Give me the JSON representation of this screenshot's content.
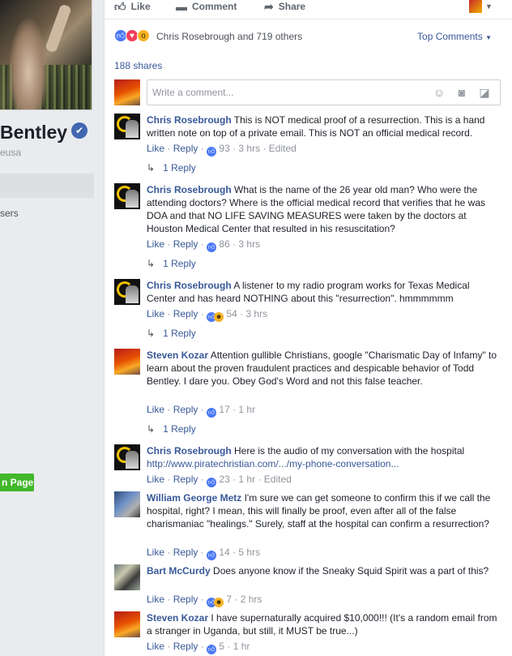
{
  "profile": {
    "name": "Bentley",
    "handle": "eusa",
    "nav_item": "sers",
    "page_button": "n Page",
    "verified_icon": "check-icon"
  },
  "actions": {
    "like": "Like",
    "comment": "Comment",
    "share": "Share"
  },
  "reactions": {
    "summary": "Chris Rosebrough and 719 others",
    "sort_label": "Top Comments"
  },
  "shares": "188 shares",
  "composer": {
    "placeholder": "Write a comment..."
  },
  "comments": [
    {
      "author": "Chris Rosebrough",
      "text": "This is NOT medical proof of a resurrection. This is a hand written note on top of a private email. This is NOT an official medical record.",
      "like": "Like",
      "reply": "Reply",
      "reaction_count": "93",
      "time": "3 hrs",
      "edited": "Edited",
      "replies": "1 Reply"
    },
    {
      "author": "Chris Rosebrough",
      "text": "What is the name of the 26 year old man? Who were the attending doctors? Where is the official medical record that verifies that he was DOA and that NO LIFE SAVING MEASURES were taken by the doctors at Houston Medical Center that resulted in his resuscitation?",
      "like": "Like",
      "reply": "Reply",
      "reaction_count": "86",
      "time": "3 hrs",
      "replies": "1 Reply"
    },
    {
      "author": "Chris Rosebrough",
      "text": "A listener to my radio program works for Texas Medical Center and has heard NOTHING about this \"resurrection\". hmmmmmm",
      "like": "Like",
      "reply": "Reply",
      "reaction_count": "54",
      "time": "3 hrs",
      "replies": "1 Reply"
    },
    {
      "author": "Steven Kozar",
      "text": "Attention gullible Christians, google \"Charismatic Day of Infamy\" to learn about the proven fraudulent practices and despicable behavior of Todd Bentley. I dare you. Obey God's Word and not this false teacher.",
      "like": "Like",
      "reply": "Reply",
      "reaction_count": "17",
      "time": "1 hr",
      "replies": "1 Reply"
    },
    {
      "author": "Chris Rosebrough",
      "text": "Here is the audio of my conversation with the hospital",
      "link": "http://www.piratechristian.com/.../my-phone-conversation...",
      "like": "Like",
      "reply": "Reply",
      "reaction_count": "23",
      "time": "1 hr",
      "edited": "Edited"
    },
    {
      "author": "William George Metz",
      "text": "I'm sure we can get someone to confirm this if we call the hospital, right? I mean, this will finally be proof, even after all of the false charismaniac \"healings.\" Surely, staff at the hospital can confirm a resurrection?",
      "like": "Like",
      "reply": "Reply",
      "reaction_count": "14",
      "time": "5 hrs"
    },
    {
      "author": "Bart McCurdy",
      "text": "Does anyone know if the Sneaky Squid Spirit was a part of this?",
      "like": "Like",
      "reply": "Reply",
      "reaction_count": "7",
      "time": "2 hrs"
    },
    {
      "author": "Steven Kozar",
      "text": "I have supernaturally acquired $10,000!!! (It's a random email from a stranger in Uganda, but still, it MUST be true...)",
      "like": "Like",
      "reply": "Reply",
      "reaction_count": "5",
      "time": "1 hr"
    }
  ]
}
